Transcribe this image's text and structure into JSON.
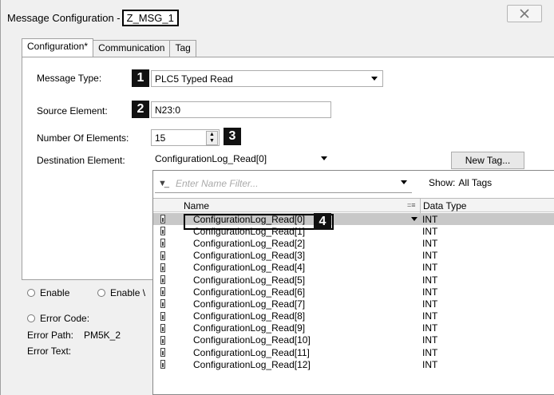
{
  "window": {
    "title_prefix": "Message Configuration - ",
    "title_name": "Z_MSG_1"
  },
  "tabs": [
    "Configuration*",
    "Communication",
    "Tag"
  ],
  "form": {
    "message_type_label": "Message Type:",
    "message_type_value": "PLC5 Typed Read",
    "source_element_label": "Source Element:",
    "source_element_value": "N23:0",
    "num_elements_label": "Number Of Elements:",
    "num_elements_value": "15",
    "destination_label": "Destination Element:",
    "destination_value": "ConfigurationLog_Read[0]",
    "new_tag_label": "New Tag..."
  },
  "badges": [
    "1",
    "2",
    "3",
    "4"
  ],
  "status": {
    "enable_label": "Enable",
    "enable_waiting_label": "Enable \\",
    "error_code_label": "Error Code:",
    "error_path_label": "Error Path:",
    "error_path_value": "PM5K_2",
    "error_text_label": "Error Text:"
  },
  "tag_browser": {
    "filter_placeholder": "Enter Name Filter...",
    "show_label": "Show:",
    "show_value": "All Tags",
    "col_name": "Name",
    "col_type": "Data Type",
    "rows": [
      {
        "name": "ConfigurationLog_Read[0]",
        "type": "INT"
      },
      {
        "name": "ConfigurationLog_Read[1]",
        "type": "INT"
      },
      {
        "name": "ConfigurationLog_Read[2]",
        "type": "INT"
      },
      {
        "name": "ConfigurationLog_Read[3]",
        "type": "INT"
      },
      {
        "name": "ConfigurationLog_Read[4]",
        "type": "INT"
      },
      {
        "name": "ConfigurationLog_Read[5]",
        "type": "INT"
      },
      {
        "name": "ConfigurationLog_Read[6]",
        "type": "INT"
      },
      {
        "name": "ConfigurationLog_Read[7]",
        "type": "INT"
      },
      {
        "name": "ConfigurationLog_Read[8]",
        "type": "INT"
      },
      {
        "name": "ConfigurationLog_Read[9]",
        "type": "INT"
      },
      {
        "name": "ConfigurationLog_Read[10]",
        "type": "INT"
      },
      {
        "name": "ConfigurationLog_Read[11]",
        "type": "INT"
      },
      {
        "name": "ConfigurationLog_Read[12]",
        "type": "INT"
      }
    ]
  }
}
